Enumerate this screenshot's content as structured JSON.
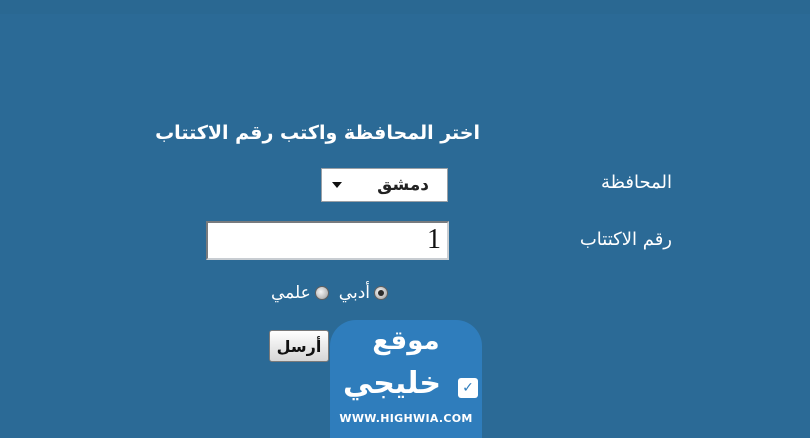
{
  "form": {
    "heading": "اختر المحافظة واكتب رقم الاكتتاب",
    "governorate_label": "المحافظة",
    "governorate_value": "دمشق",
    "registration_label": "رقم الاكتتاب",
    "registration_value": "1",
    "radio_options": [
      {
        "label": "أدبي",
        "checked": true
      },
      {
        "label": "علمي",
        "checked": false
      }
    ],
    "submit_label": "أرسل"
  },
  "watermark": {
    "line1": "موقع",
    "line2": "خليجي",
    "url": "WWW.HIGHWIA.COM"
  },
  "colors": {
    "background": "#2b6a96",
    "watermark": "#2f7dbc"
  }
}
